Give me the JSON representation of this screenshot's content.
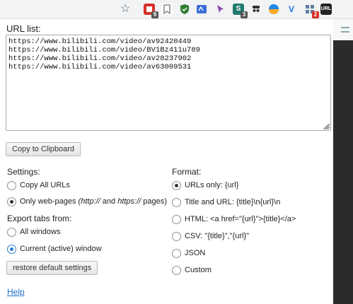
{
  "toolbar": {
    "star_icon": "star-outline-icon",
    "extensions": [
      {
        "name": "ext-red-adblock",
        "bg": "#d93025",
        "glyph": "",
        "badge": "9",
        "badge_bg": "#555555"
      },
      {
        "name": "ext-bookmark",
        "bg": "#ffffff",
        "glyph": "",
        "badge": "",
        "badge_bg": ""
      },
      {
        "name": "ext-shield",
        "bg": "#2e7d32",
        "glyph": "",
        "badge": "",
        "badge_bg": ""
      },
      {
        "name": "ext-grammar",
        "bg": "#3b6dd8",
        "glyph": "",
        "badge": "",
        "badge_bg": ""
      },
      {
        "name": "ext-arrow",
        "bg": "#ffffff",
        "glyph": "",
        "badge": "",
        "badge_bg": ""
      },
      {
        "name": "ext-s",
        "bg": "#1f7a6d",
        "glyph": "S",
        "badge": "3",
        "badge_bg": "#555555"
      },
      {
        "name": "ext-spy",
        "bg": "#ffffff",
        "glyph": "",
        "badge": "",
        "badge_bg": ""
      },
      {
        "name": "ext-half-circle",
        "bg": "#1e88e5",
        "glyph": "",
        "badge": "",
        "badge_bg": ""
      },
      {
        "name": "ext-v",
        "bg": "#ffffff",
        "glyph": "V",
        "badge": "",
        "badge_bg": ""
      },
      {
        "name": "ext-grid",
        "bg": "#5f7ea0",
        "glyph": "",
        "badge": "2",
        "badge_bg": "#d93025"
      },
      {
        "name": "ext-url",
        "bg": "#222222",
        "glyph": "URL",
        "badge": "",
        "badge_bg": ""
      }
    ]
  },
  "popup": {
    "title": "URL list:",
    "urls": "https://www.bilibili.com/video/av92420449\nhttps://www.bilibili.com/video/BV1Bz411u789\nhttps://www.bilibili.com/video/av28237902\nhttps://www.bilibili.com/video/av63009531",
    "copy_button": "Copy to Clipboard",
    "settings_label": "Settings:",
    "settings": {
      "copy_all": "Copy All URLs",
      "only_web_prefix": "Only web-pages ",
      "only_web_http": "(http://",
      "only_web_and": " and ",
      "only_web_https": "https://",
      "only_web_suffix": " pages)",
      "selected": "only_web"
    },
    "export_label": "Export tabs from:",
    "export": {
      "all_windows": "All windows",
      "current_window": "Current (active) window",
      "selected": "current_window"
    },
    "restore_button": "restore default settings",
    "format_label": "Format:",
    "formats": [
      {
        "id": "urls_only",
        "label": "URLs only: {url}",
        "checked": true
      },
      {
        "id": "title_url",
        "label": "Title and URL: {title}\\n{url}\\n",
        "checked": false
      },
      {
        "id": "html",
        "label": "HTML: <a href=\"{url}\">{title}</a>",
        "checked": false
      },
      {
        "id": "csv",
        "label": "CSV: \"{title}\",\"{url}\"",
        "checked": false
      },
      {
        "id": "json",
        "label": "JSON",
        "checked": false
      },
      {
        "id": "custom",
        "label": "Custom",
        "checked": false
      }
    ],
    "help_link": "Help"
  },
  "colors": {
    "accent_blue": "#2b7cd3",
    "link": "#1a6fc9"
  }
}
